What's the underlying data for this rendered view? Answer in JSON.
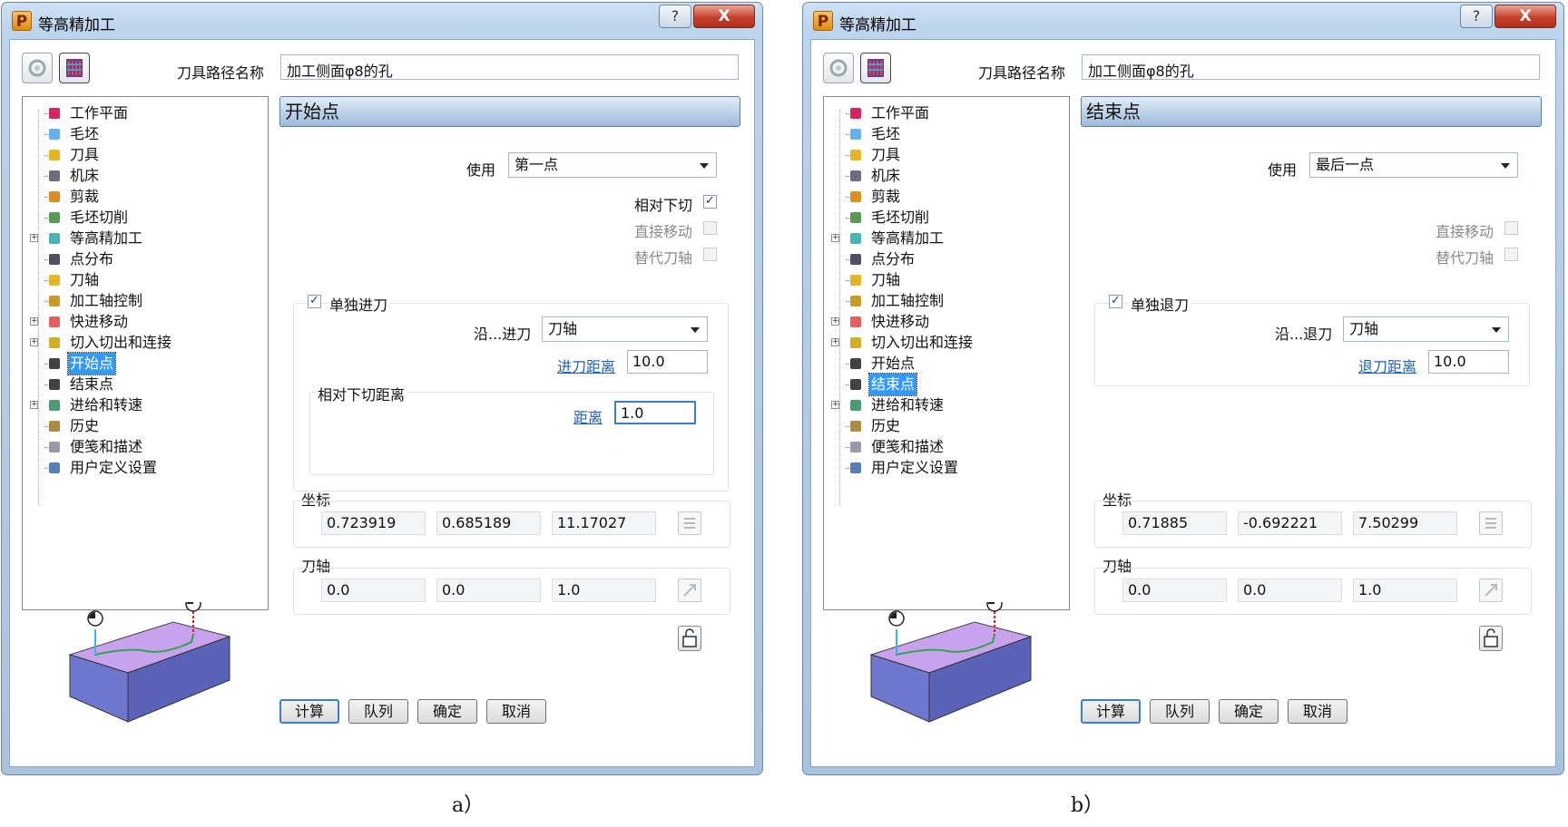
{
  "dialog_a": {
    "title": "等高精加工",
    "help": "?",
    "close": "X",
    "toolpath_name_label": "刀具路径名称",
    "toolpath_name_value": "加工侧面φ8的孔",
    "tree": [
      {
        "label": "工作平面",
        "icon": "workplane-icon",
        "expand": false
      },
      {
        "label": "毛坯",
        "icon": "block-icon",
        "expand": false
      },
      {
        "label": "刀具",
        "icon": "tool-icon",
        "expand": false
      },
      {
        "label": "机床",
        "icon": "machine-icon",
        "expand": false
      },
      {
        "label": "剪裁",
        "icon": "trim-icon",
        "expand": false
      },
      {
        "label": "毛坯切削",
        "icon": "stock-cut-icon",
        "expand": false
      },
      {
        "label": "等高精加工",
        "icon": "constant-z-icon",
        "expand": true
      },
      {
        "label": "点分布",
        "icon": "point-distribution-icon",
        "expand": false
      },
      {
        "label": "刀轴",
        "icon": "tool-axis-icon",
        "expand": false
      },
      {
        "label": "加工轴控制",
        "icon": "axis-control-icon",
        "expand": false
      },
      {
        "label": "快进移动",
        "icon": "rapid-move-icon",
        "expand": true
      },
      {
        "label": "切入切出和连接",
        "icon": "leads-links-icon",
        "expand": true
      },
      {
        "label": "开始点",
        "icon": "start-point-icon",
        "expand": false,
        "selected": true
      },
      {
        "label": "结束点",
        "icon": "end-point-icon",
        "expand": false
      },
      {
        "label": "进给和转速",
        "icon": "feeds-speeds-icon",
        "expand": true
      },
      {
        "label": "历史",
        "icon": "history-icon",
        "expand": false
      },
      {
        "label": "便笺和描述",
        "icon": "notes-icon",
        "expand": false
      },
      {
        "label": "用户定义设置",
        "icon": "user-settings-icon",
        "expand": false
      }
    ],
    "section_title": "开始点",
    "use_label": "使用",
    "use_value": "第一点",
    "relative_plunge_label": "相对下切",
    "relative_plunge_checked": true,
    "direct_move_label": "直接移动",
    "alt_axis_label": "替代刀轴",
    "separate_label": "单独进刀",
    "along_label": "沿...进刀",
    "along_value": "刀轴",
    "distance_link_label": "进刀距离",
    "distance_value": "10.0",
    "plunge_group_label": "相对下切距离",
    "plunge_distance_label": "距离",
    "plunge_distance_value": "1.0",
    "coord_label": "坐标",
    "coords": [
      "0.723919",
      "0.685189",
      "11.17027"
    ],
    "axis_label": "刀轴",
    "axis": [
      "0.0",
      "0.0",
      "1.0"
    ],
    "buttons": [
      "计算",
      "队列",
      "确定",
      "取消"
    ],
    "caption": "a）"
  },
  "dialog_b": {
    "title": "等高精加工",
    "help": "?",
    "close": "X",
    "toolpath_name_label": "刀具路径名称",
    "toolpath_name_value": "加工侧面φ8的孔",
    "tree": [
      {
        "label": "工作平面",
        "icon": "workplane-icon",
        "expand": false
      },
      {
        "label": "毛坯",
        "icon": "block-icon",
        "expand": false
      },
      {
        "label": "刀具",
        "icon": "tool-icon",
        "expand": false
      },
      {
        "label": "机床",
        "icon": "machine-icon",
        "expand": false
      },
      {
        "label": "剪裁",
        "icon": "trim-icon",
        "expand": false
      },
      {
        "label": "毛坯切削",
        "icon": "stock-cut-icon",
        "expand": false
      },
      {
        "label": "等高精加工",
        "icon": "constant-z-icon",
        "expand": true
      },
      {
        "label": "点分布",
        "icon": "point-distribution-icon",
        "expand": false
      },
      {
        "label": "刀轴",
        "icon": "tool-axis-icon",
        "expand": false
      },
      {
        "label": "加工轴控制",
        "icon": "axis-control-icon",
        "expand": false
      },
      {
        "label": "快进移动",
        "icon": "rapid-move-icon",
        "expand": true
      },
      {
        "label": "切入切出和连接",
        "icon": "leads-links-icon",
        "expand": true
      },
      {
        "label": "开始点",
        "icon": "start-point-icon",
        "expand": false
      },
      {
        "label": "结束点",
        "icon": "end-point-icon",
        "expand": false,
        "selected": true
      },
      {
        "label": "进给和转速",
        "icon": "feeds-speeds-icon",
        "expand": true
      },
      {
        "label": "历史",
        "icon": "history-icon",
        "expand": false
      },
      {
        "label": "便笺和描述",
        "icon": "notes-icon",
        "expand": false
      },
      {
        "label": "用户定义设置",
        "icon": "user-settings-icon",
        "expand": false
      }
    ],
    "section_title": "结束点",
    "use_label": "使用",
    "use_value": "最后一点",
    "direct_move_label": "直接移动",
    "alt_axis_label": "替代刀轴",
    "separate_label": "单独退刀",
    "along_label": "沿...退刀",
    "along_value": "刀轴",
    "distance_link_label": "退刀距离",
    "distance_value": "10.0",
    "coord_label": "坐标",
    "coords": [
      "0.71885",
      "-0.692221",
      "7.50299"
    ],
    "axis_label": "刀轴",
    "axis": [
      "0.0",
      "0.0",
      "1.0"
    ],
    "buttons": [
      "计算",
      "队列",
      "确定",
      "取消"
    ],
    "caption": "b）"
  },
  "colors": {
    "title_gradient": "#bcd4ec",
    "selected_item": "#3399ff",
    "link": "#1f5fbf",
    "preview_top": "#c9a2ee",
    "preview_side": "#6f78cf"
  }
}
